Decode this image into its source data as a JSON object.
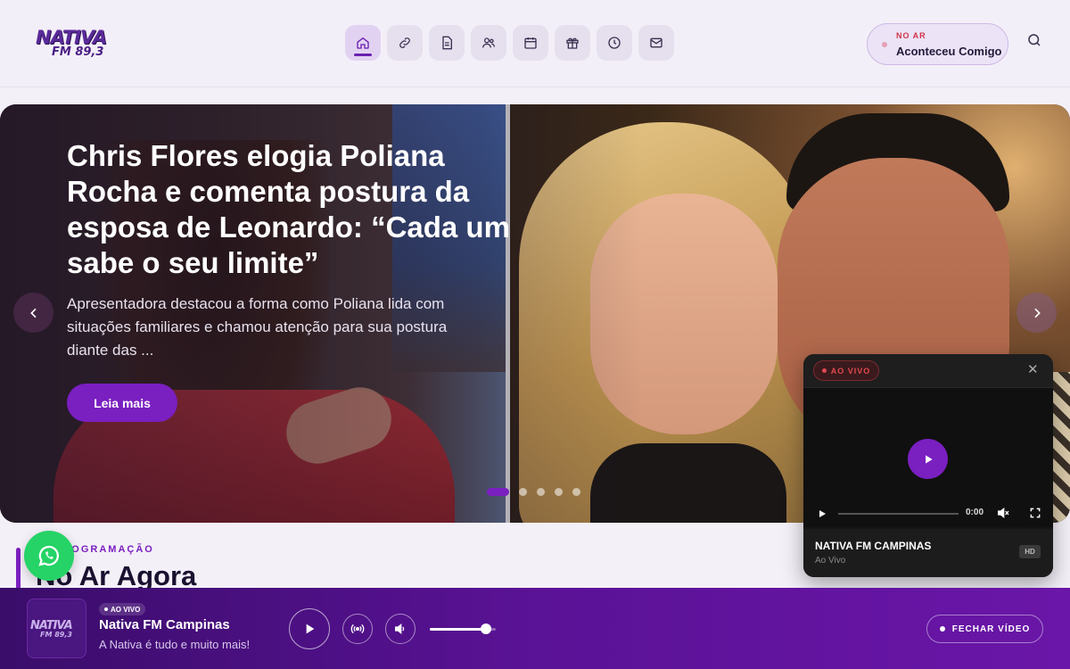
{
  "header": {
    "logo_line1": "NATIVA",
    "logo_line2": "FM 89,3",
    "nav_icons": [
      "home-icon",
      "link-icon",
      "document-icon",
      "users-icon",
      "calendar-icon",
      "gift-icon",
      "clock-icon",
      "mail-icon"
    ],
    "active_nav": "home-icon",
    "on_air_label": "NO AR",
    "on_air_program": "Aconteceu Comigo",
    "search_icon": "search-icon"
  },
  "hero": {
    "title": "Chris Flores elogia Poliana Rocha e comenta postura da esposa de Leonardo: “Cada um sabe o seu limite”",
    "description": "Apresentadora destacou a forma como Poliana lida com situações familiares e chamou atenção para sua postura diante das ...",
    "cta_label": "Leia mais",
    "slide_count": 5,
    "active_slide": 1
  },
  "programacao": {
    "tag": "PROGRAMAÇÃO",
    "title": "No Ar Agora"
  },
  "video_card": {
    "live_label": "AO VIVO",
    "time": "0:00",
    "station_name": "NATIVA FM CAMPINAS",
    "status": "Ao Vivo",
    "quality": "HD"
  },
  "player": {
    "logo_line1": "NATIVA",
    "logo_line2": "FM 89,3",
    "live_label": "AO VIVO",
    "station_name": "Nativa FM Campinas",
    "slogan": "A Nativa é tudo e muito mais!",
    "volume": 0.85,
    "close_video_label": "FECHAR VÍDEO"
  },
  "colors": {
    "accent": "#7a1fc0",
    "live_red": "#e24a50",
    "whatsapp": "#25d366"
  }
}
